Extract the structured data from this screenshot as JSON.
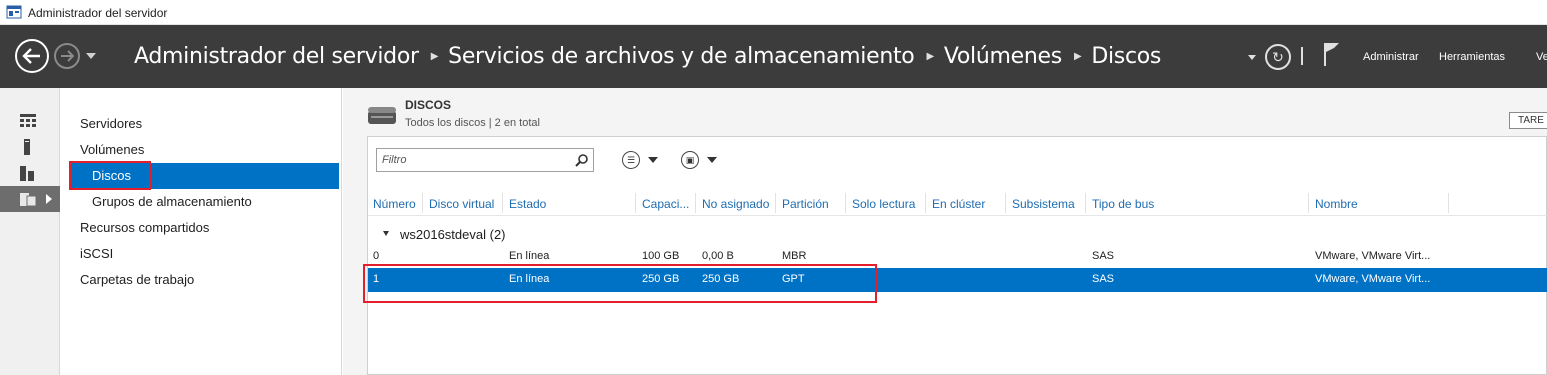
{
  "window": {
    "title": "Administrador del servidor"
  },
  "header": {
    "breadcrumb": [
      "Administrador del servidor",
      "Servicios de archivos y de almacenamiento",
      "Volúmenes",
      "Discos"
    ],
    "menu": [
      "Administrar",
      "Herramientas",
      "Ve"
    ]
  },
  "navpane": {
    "items": [
      {
        "label": "Servidores"
      },
      {
        "label": "Volúmenes"
      },
      {
        "label": "Discos",
        "selected": true
      },
      {
        "label": "Grupos de almacenamiento"
      },
      {
        "label": "Recursos compartidos"
      },
      {
        "label": "iSCSI"
      },
      {
        "label": "Carpetas de trabajo"
      }
    ]
  },
  "section": {
    "title": "DISCOS",
    "subtitle": "Todos los discos | 2 en total",
    "tasks_label": "TARE",
    "filter_placeholder": "Filtro"
  },
  "table": {
    "columns": [
      "Número",
      "Disco virtual",
      "Estado",
      "Capaci...",
      "No asignado",
      "Partición",
      "Solo lectura",
      "En clúster",
      "Subsistema",
      "Tipo de bus",
      "Nombre"
    ],
    "group": "ws2016stdeval (2)",
    "rows": [
      {
        "numero": "0",
        "estado": "En línea",
        "capacidad": "100 GB",
        "no_asignado": "0,00 B",
        "particion": "MBR",
        "tipo_bus": "SAS",
        "nombre": "VMware, VMware Virt..."
      },
      {
        "numero": "1",
        "estado": "En línea",
        "capacidad": "250 GB",
        "no_asignado": "250 GB",
        "particion": "GPT",
        "tipo_bus": "SAS",
        "nombre": "VMware, VMware Virt...",
        "selected": true
      }
    ]
  },
  "colors": {
    "header_bg": "#3c3c3c",
    "selection": "#0072c6",
    "highlight_box": "#e41e2b",
    "column_header_text": "#1f6db0"
  },
  "icons": [
    "server-manager-icon",
    "back-arrow-icon",
    "forward-arrow-icon",
    "refresh-icon",
    "flag-icon",
    "dashboard-icon",
    "local-server-icon",
    "all-servers-icon",
    "file-storage-icon",
    "disk-icon",
    "search-icon",
    "list-view-icon",
    "save-icon"
  ]
}
